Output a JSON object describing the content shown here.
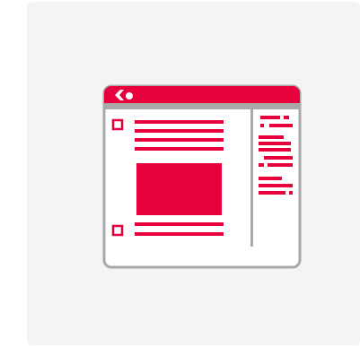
{
  "illustration": {
    "icon": "browser-window-layout-icon",
    "colors": {
      "accent": "#e8003d",
      "frame": "#a9a9a9",
      "card_background": "#f4f4f4",
      "window_background": "#ffffff"
    }
  }
}
